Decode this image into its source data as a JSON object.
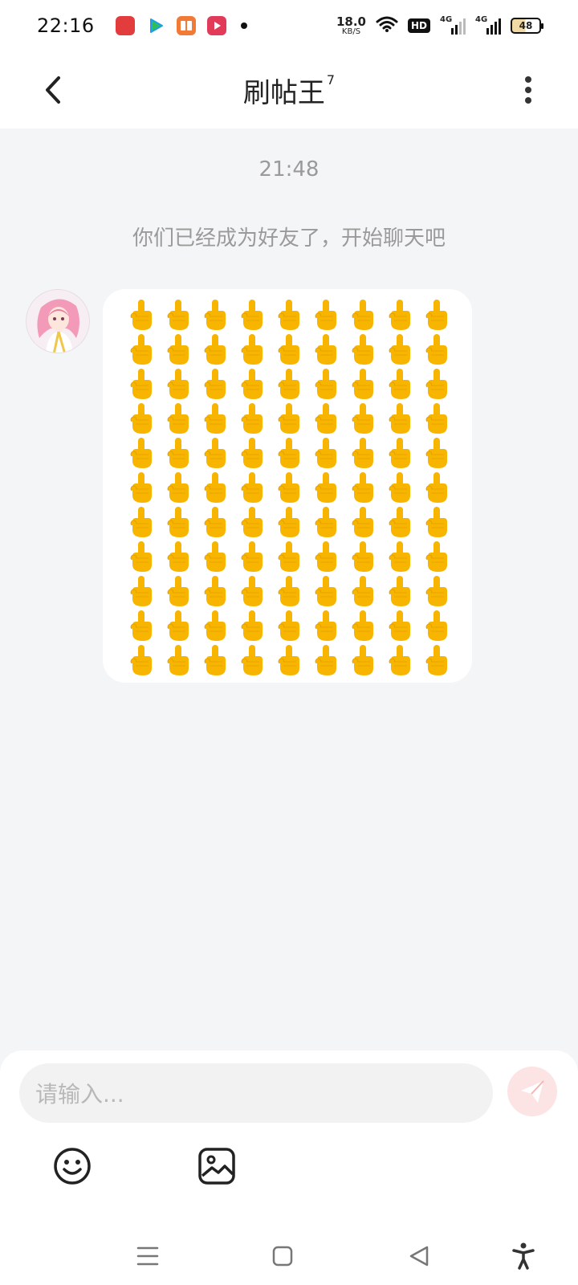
{
  "status_bar": {
    "time": "22:16",
    "net_speed_value": "18.0",
    "net_speed_unit": "KB/S",
    "hd_label": "HD",
    "signal_1_label": "4G",
    "signal_2_label": "4G",
    "battery_level": "48"
  },
  "header": {
    "title": "刷帖王",
    "level": "7"
  },
  "chat": {
    "timestamp": "21:48",
    "system_message": "你们已经成为好友了，开始聊天吧",
    "message": {
      "emoji": "🖕",
      "emoji_rows": 11,
      "emoji_cols": 9
    }
  },
  "input": {
    "placeholder": "请输入..."
  },
  "colors": {
    "accent_send": "#f36b6b",
    "background": "#f4f5f7",
    "emoji_yellow": "#f7b500"
  },
  "icons": {
    "back": "back-arrow-icon",
    "more": "more-vertical-icon",
    "send": "send-plane-icon",
    "emoji": "smiley-icon",
    "image": "image-icon",
    "nav_menu": "menu-lines-icon",
    "nav_home": "home-square-icon",
    "nav_back": "back-triangle-icon",
    "accessibility": "accessibility-icon"
  }
}
